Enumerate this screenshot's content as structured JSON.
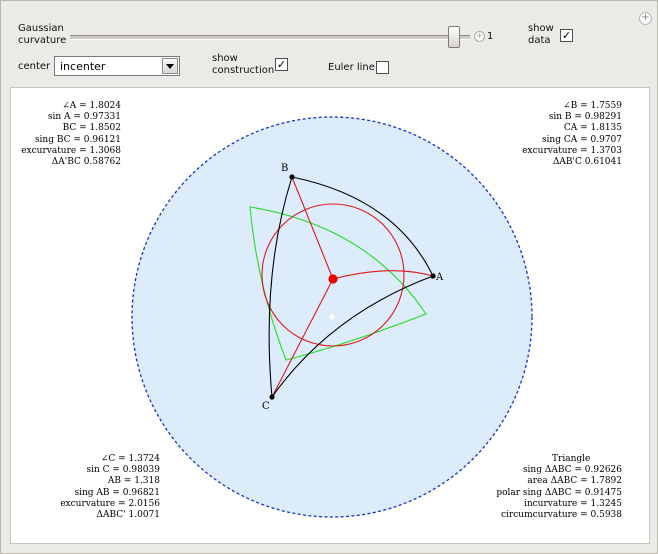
{
  "controls": {
    "curvature_label_1": "Gaussian",
    "curvature_label_2": "curvature",
    "curvature_value": "1",
    "curvature_fraction": 0.97,
    "show_data_label_1": "show",
    "show_data_label_2": "data",
    "show_data_checked": "✓",
    "center_label": "center",
    "center_value": "incenter",
    "show_construction_label_1": "show",
    "show_construction_label_2": "construction",
    "show_construction_checked": "✓",
    "euler_label": "Euler line",
    "euler_checked": ""
  },
  "colors": {
    "disk_fill": "#ddecfb",
    "disk_border": "#1530d8",
    "triangle": "#000000",
    "incircle": "#e01818",
    "construction": "#e01818",
    "polar_triangle": "#22dd22",
    "center_dot": "#ee0000"
  },
  "vertices": {
    "A": "A",
    "B": "B",
    "C": "C"
  },
  "data_top_left": [
    "∠A = 1.8024",
    "sin A = 0.97331",
    "BC = 1.8502",
    "sing BC = 0.96121",
    "excurvature = 1.3068",
    "ΔA'BC  0.58762"
  ],
  "data_top_right": [
    "∠B = 1.7559",
    "sin B = 0.98291",
    "CA = 1.8135",
    "sing CA = 0.9707",
    "excurvature = 1.3703",
    "ΔAB'C  0.61041"
  ],
  "data_bottom_left": [
    "∠C = 1.3724",
    "sin C = 0.98039",
    "AB = 1.318",
    "sing AB = 0.96821",
    "excurvature = 2.0156",
    "ΔABC'  1.0071"
  ],
  "data_bottom_right": [
    "Triangle",
    "sing ΔABC = 0.92626",
    "area ΔABC = 1.7892",
    "polar sing ΔABC = 0.91475",
    "incurvature = 1.3245",
    "circumcurvature = 0.5938"
  ]
}
